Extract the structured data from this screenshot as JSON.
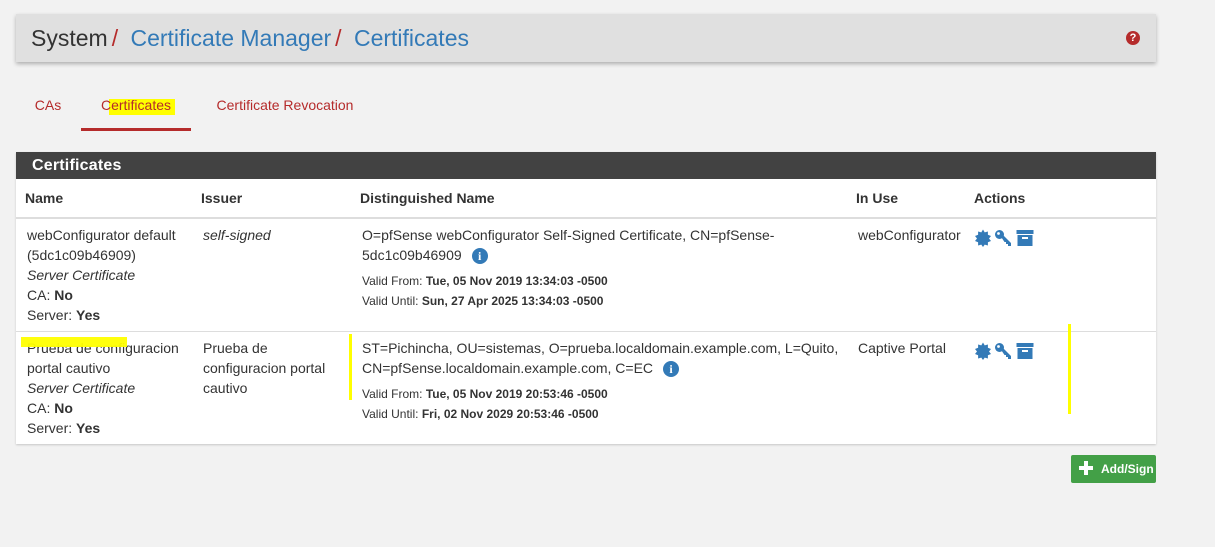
{
  "breadcrumb": {
    "root": "System",
    "separator": "/",
    "items": [
      "Certificate Manager",
      "Certificates"
    ]
  },
  "help_icon": "question-circle-icon",
  "tabs": [
    {
      "label": "CAs",
      "active": false
    },
    {
      "label": "Certificates",
      "active": true
    },
    {
      "label": "Certificate Revocation",
      "active": false
    }
  ],
  "panel": {
    "title": "Certificates",
    "columns": [
      "Name",
      "Issuer",
      "Distinguished Name",
      "In Use",
      "Actions"
    ],
    "rows": [
      {
        "name_line1": "webConfigurator default",
        "name_line2": "(5dc1c09b46909)",
        "cert_type": "Server Certificate",
        "ca_label": "CA:",
        "ca_value": "No",
        "server_label": "Server:",
        "server_value": "Yes",
        "issuer": "self-signed",
        "dn_line1": "O=pfSense webConfigurator Self-Signed Certificate, CN=pfSense-",
        "dn_line2": "5dc1c09b46909",
        "valid_from_label": "Valid From:",
        "valid_from": "Tue, 05 Nov 2019 13:34:03 -0500",
        "valid_until_label": "Valid Until:",
        "valid_until": "Sun, 27 Apr 2025 13:34:03 -0500",
        "in_use": "webConfigurator"
      },
      {
        "name_line1": "Prueba de configuracion",
        "name_line2": "portal cautivo",
        "cert_type": "Server Certificate",
        "ca_label": "CA:",
        "ca_value": "No",
        "server_label": "Server:",
        "server_value": "Yes",
        "issuer_line1": "Prueba de",
        "issuer_line2": "configuracion portal",
        "issuer_line3": "cautivo",
        "dn_line1": "ST=Pichincha, OU=sistemas, O=prueba.localdomain.example.com, L=Quito,",
        "dn_line2": "CN=pfSense.localdomain.example.com, C=EC",
        "valid_from_label": "Valid From:",
        "valid_from": "Tue, 05 Nov 2019 20:53:46 -0500",
        "valid_until_label": "Valid Until:",
        "valid_until": "Fri, 02 Nov 2029 20:53:46 -0500",
        "in_use": "Captive Portal"
      }
    ],
    "action_icons": [
      "cog-icon",
      "key-icon",
      "archive-icon"
    ]
  },
  "add_button": {
    "label": "Add/Sign",
    "icon": "plus-icon"
  },
  "colors": {
    "link": "#337ab7",
    "accent_red": "#b52b2b",
    "panel_header": "#424242",
    "button_green": "#43a047",
    "highlight_marker": "#ffff00"
  }
}
